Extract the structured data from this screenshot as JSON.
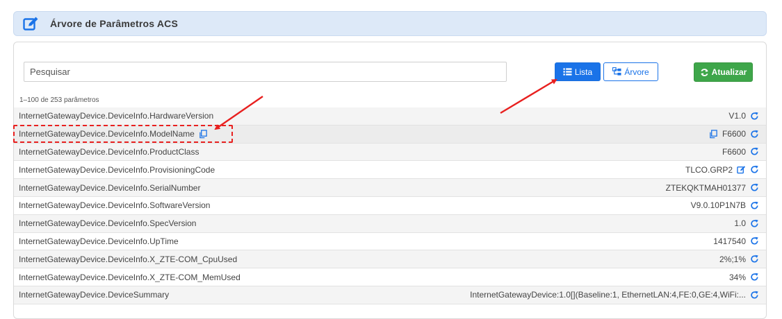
{
  "header": {
    "title": "Árvore de Parâmetros ACS",
    "icon": "edit-icon"
  },
  "search": {
    "placeholder": "Pesquisar",
    "value": ""
  },
  "buttons": {
    "lista": "Lista",
    "arvore": "Árvore",
    "atualizar": "Atualizar"
  },
  "count_text": "1–100 de 253 parâmetros",
  "colors": {
    "primary": "#1a73e8",
    "success": "#3ea64a",
    "highlight": "#e8201f",
    "header_bg": "#dde9f8"
  },
  "rows": [
    {
      "name": "InternetGatewayDevice.DeviceInfo.HardwareVersion",
      "value": "V1.0"
    },
    {
      "name": "InternetGatewayDevice.DeviceInfo.ModelName",
      "value": "F6600"
    },
    {
      "name": "InternetGatewayDevice.DeviceInfo.ProductClass",
      "value": "F6600"
    },
    {
      "name": "InternetGatewayDevice.DeviceInfo.ProvisioningCode",
      "value": "TLCO.GRP2"
    },
    {
      "name": "InternetGatewayDevice.DeviceInfo.SerialNumber",
      "value": "ZTEKQKTMAH01377"
    },
    {
      "name": "InternetGatewayDevice.DeviceInfo.SoftwareVersion",
      "value": "V9.0.10P1N7B"
    },
    {
      "name": "InternetGatewayDevice.DeviceInfo.SpecVersion",
      "value": "1.0"
    },
    {
      "name": "InternetGatewayDevice.DeviceInfo.UpTime",
      "value": "1417540"
    },
    {
      "name": "InternetGatewayDevice.DeviceInfo.X_ZTE-COM_CpuUsed",
      "value": "2%;1%"
    },
    {
      "name": "InternetGatewayDevice.DeviceInfo.X_ZTE-COM_MemUsed",
      "value": "34%"
    },
    {
      "name": "InternetGatewayDevice.DeviceSummary",
      "value": "InternetGatewayDevice:1.0[](Baseline:1, EthernetLAN:4,FE:0,GE:4,WiFi:..."
    }
  ]
}
